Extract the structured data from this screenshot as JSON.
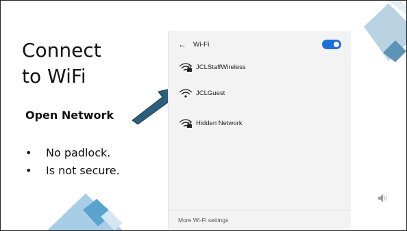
{
  "slide": {
    "title_line1": "Connect",
    "title_line2": "to WiFi",
    "subtitle": "Open Network",
    "bullets": [
      "No padlock.",
      "Is not secure."
    ],
    "accent_color": "#8db7cf"
  },
  "wifi_panel": {
    "back_glyph": "←",
    "title": "Wi-Fi",
    "toggle_on": true,
    "networks": [
      {
        "name": "JCLStaffWireless",
        "locked": true
      },
      {
        "name": "JCLGuest",
        "locked": false
      },
      {
        "name": "Hidden Network",
        "locked": true
      }
    ],
    "footer_link": "More Wi-Fi settings"
  },
  "icons": [
    "back-arrow-icon",
    "wifi-lock-icon",
    "wifi-open-icon",
    "pointer-arrow-icon",
    "speaker-icon"
  ]
}
